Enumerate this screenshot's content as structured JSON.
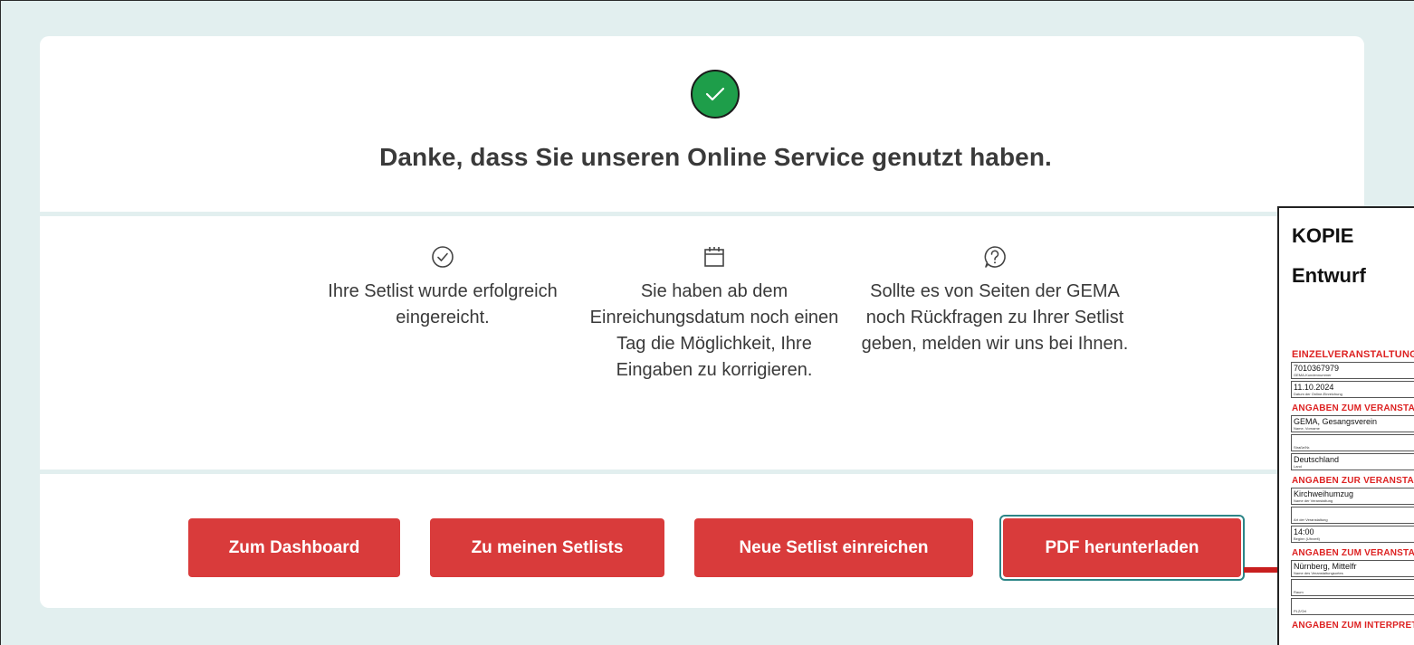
{
  "confirmation": {
    "headline": "Danke, dass Sie unseren Online Service genutzt haben."
  },
  "info_items": [
    {
      "icon": "check-circle-outline-icon",
      "text": "Ihre Setlist wurde erfolgreich eingereicht."
    },
    {
      "icon": "calendar-icon",
      "text": "Sie haben ab dem Einreichungsdatum noch einen Tag die Möglichkeit, Ihre Eingaben zu korrigieren."
    },
    {
      "icon": "question-circle-icon",
      "text": "Sollte es von Seiten der GEMA noch Rückfragen zu Ihrer Setlist geben, melden wir uns bei Ihnen."
    }
  ],
  "buttons": {
    "dashboard": "Zum Dashboard",
    "my_setlists": "Zu meinen Setlists",
    "new_setlist": "Neue Setlist einreichen",
    "pdf_download": "PDF herunterladen"
  },
  "pdf_preview": {
    "kopie": "KOPIE",
    "entwurf": "Entwurf",
    "main_heading": "EINZELVERANSTALTUNG",
    "fields_top": [
      {
        "value": "7010367979",
        "label": "GEMA-Kundennummer"
      },
      {
        "value": "11.10.2024",
        "label": "Datum der Online-Einreichung"
      }
    ],
    "section_veranstalter": "ANGABEN ZUM VERANSTALTER",
    "fields_veranstalter": [
      {
        "value": "GEMA, Gesangsverein",
        "label": "Name, Vorname"
      },
      {
        "value": "",
        "label": "Straße/Nr."
      },
      {
        "value": "Deutschland",
        "label": "Land"
      }
    ],
    "section_veranstaltung": "ANGABEN ZUR VERANSTALTUNG",
    "fields_veranstaltung": [
      {
        "value": "Kirchweihumzug",
        "label": "Name der Veranstaltung"
      },
      {
        "value": "",
        "label": "Art der Veranstaltung"
      },
      {
        "value": "14:00",
        "label": "Beginn (Uhrzeit)"
      }
    ],
    "section_ort": "ANGABEN ZUM VERANSTALTUNGSORT",
    "fields_ort": [
      {
        "value": "Nürnberg, Mittelfr",
        "label": "Name des Veranstaltungsortes"
      },
      {
        "value": "",
        "label": "Raum"
      },
      {
        "value": "",
        "label": "PLZ/Ort"
      }
    ],
    "section_interpreten": "ANGABEN ZUM INTERPRETEN"
  },
  "colors": {
    "page_bg": "#e2efef",
    "button_red": "#d93b3b",
    "success_green": "#1e9e4a",
    "focus_teal": "#2c8587",
    "pdf_red": "#d22"
  }
}
